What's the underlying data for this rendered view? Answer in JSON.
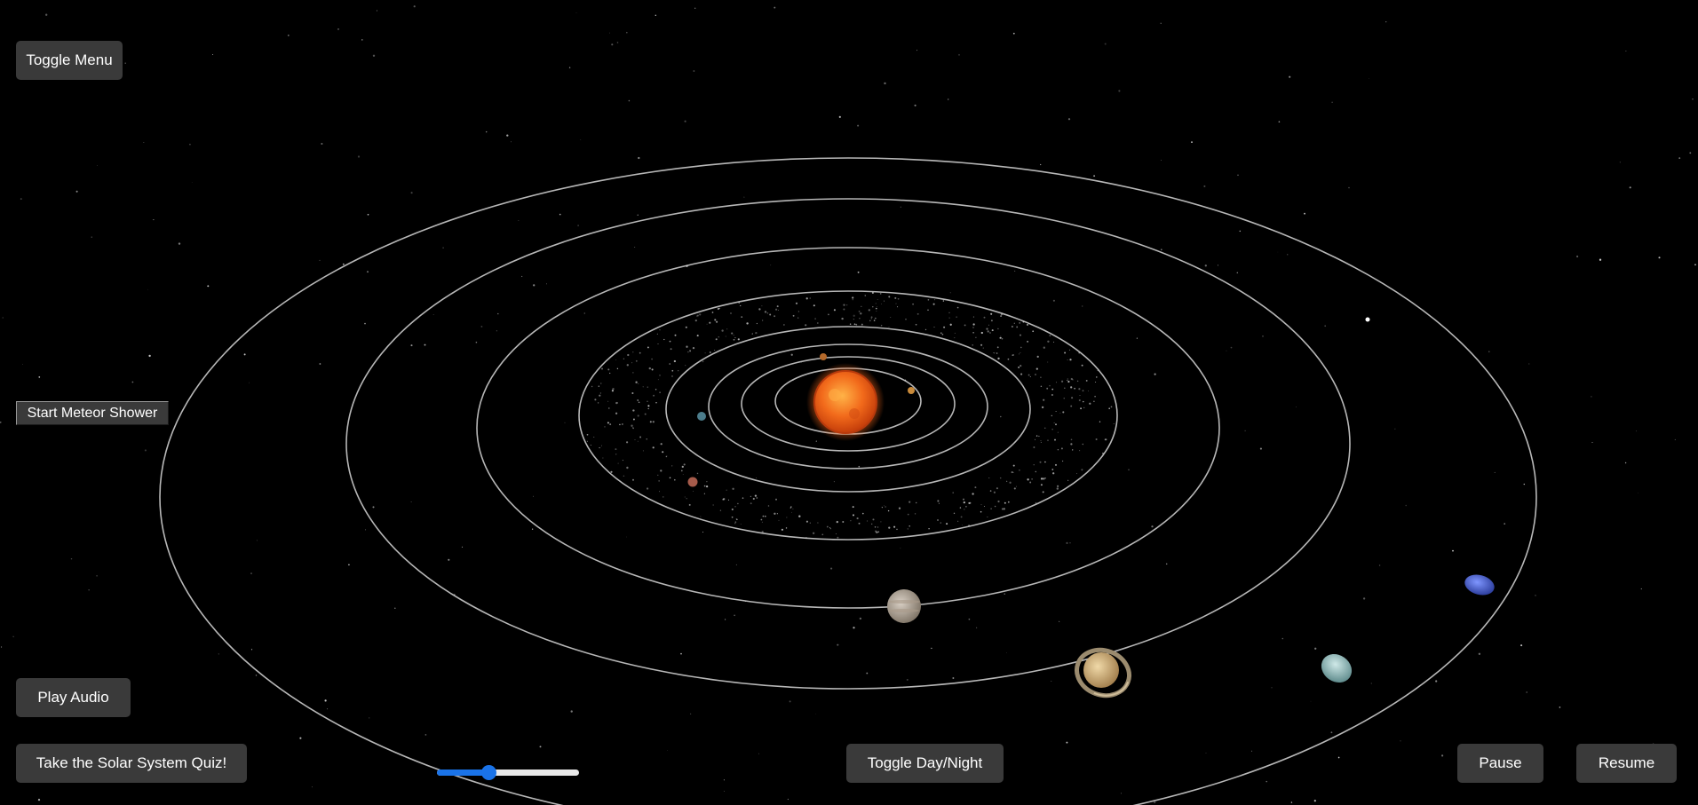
{
  "controls": {
    "toggle_menu_label": "Toggle Menu",
    "meteor_shower_label": "Start Meteor Shower",
    "play_audio_label": "Play Audio",
    "quiz_label": "Take the Solar System Quiz!",
    "day_night_label": "Toggle Day/Night",
    "pause_label": "Pause",
    "resume_label": "Resume"
  },
  "speed_slider": {
    "value_fraction": 0.36
  },
  "colors": {
    "background": "#000000",
    "button_bg": "#3a3a3a",
    "button_text": "#ffffff",
    "slider_accent": "#1a73e8",
    "orbit_line": "#d8d8d8",
    "sun": "#f26a1b"
  },
  "scene": {
    "bodies": [
      "sun",
      "mercury",
      "venus",
      "earth",
      "mars",
      "asteroid-belt",
      "jupiter",
      "saturn",
      "uranus",
      "neptune"
    ]
  }
}
